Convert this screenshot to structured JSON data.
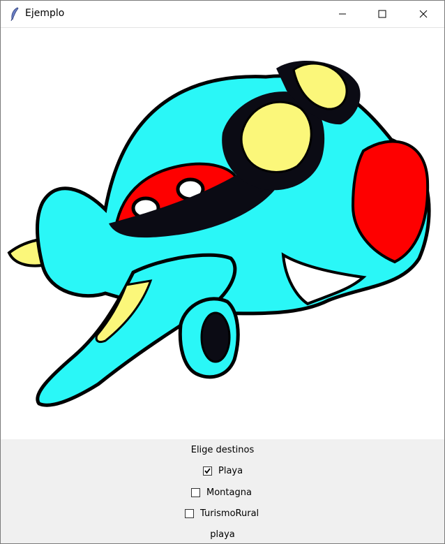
{
  "window": {
    "title": "Ejemplo"
  },
  "panel": {
    "heading": "Elige destinos",
    "options": [
      {
        "label": "Playa",
        "checked": true
      },
      {
        "label": "Montagna",
        "checked": false
      },
      {
        "label": "TurismoRural",
        "checked": false
      }
    ],
    "result": "playa"
  },
  "colors": {
    "body": "#2af7f7",
    "goggle": "#fbf77a",
    "nose": "#fe0000",
    "outline": "#0b0b14"
  }
}
